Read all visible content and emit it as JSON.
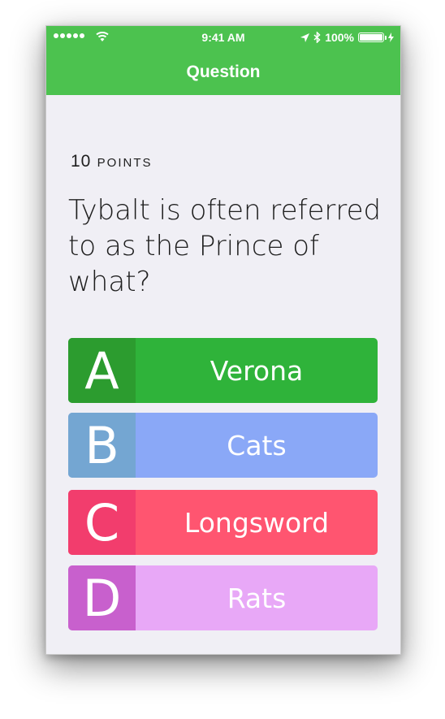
{
  "status_bar": {
    "time": "9:41 AM",
    "battery_percent": "100%",
    "battery_level": 1.0
  },
  "nav": {
    "title": "Question"
  },
  "question": {
    "points_number": "10",
    "points_word": "points",
    "text": "Tybalt is often referred to as the Prince of what?"
  },
  "answers": [
    {
      "letter": "A",
      "label": "Verona",
      "letter_color": "#2c9c2f",
      "label_color": "#2fb33a"
    },
    {
      "letter": "B",
      "label": "Cats",
      "letter_color": "#74a6d2",
      "label_color": "#8aa8f7"
    },
    {
      "letter": "C",
      "label": "Longsword",
      "letter_color": "#f23d6d",
      "label_color": "#ff5570"
    },
    {
      "letter": "D",
      "label": "Rats",
      "letter_color": "#c860cd",
      "label_color": "#e8a8f7"
    }
  ],
  "colors": {
    "accent": "#4cc24f",
    "background": "#f0eff5"
  }
}
